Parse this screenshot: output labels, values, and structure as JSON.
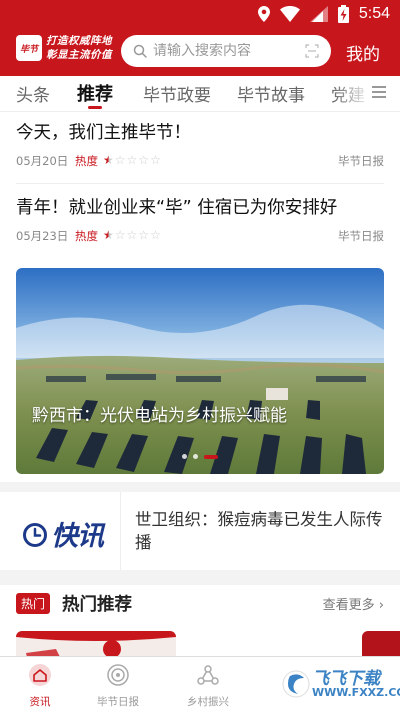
{
  "status_bar": {
    "time": "5:54",
    "icons": [
      "location-icon",
      "wifi-icon",
      "signal-icon",
      "battery-charging-icon"
    ]
  },
  "header": {
    "logo_text": "毕节",
    "slogan_line1": "打造权威阵地",
    "slogan_line2": "彰显主流价值",
    "search_placeholder": "请输入搜索内容",
    "mine_label": "我的"
  },
  "tabs": [
    {
      "label": "头条"
    },
    {
      "label": "推荐"
    },
    {
      "label": "毕节政要"
    },
    {
      "label": "毕节故事"
    },
    {
      "label": "党建"
    }
  ],
  "active_tab": "推荐",
  "news": [
    {
      "title": "今天，我们主推毕节！",
      "date": "05月20日",
      "heat_label": "热度",
      "heat_rating": 0.5,
      "source": "毕节日报"
    },
    {
      "title": "青年！就业创业来“毕” 住宿已为你安排好",
      "date": "05月23日",
      "heat_label": "热度",
      "heat_rating": 0.5,
      "source": "毕节日报"
    }
  ],
  "banner": {
    "caption": "黔西市：光伏电站为乡村振兴赋能",
    "slide_count": 3,
    "active_slide": 3
  },
  "kuaixun": {
    "logo_text": "快讯",
    "headline": "世卫组织：猴痘病毒已发生人际传播"
  },
  "hot": {
    "badge": "热门",
    "title": "热门推荐",
    "more_label": "查看更多"
  },
  "bottom_nav": [
    {
      "label": "资讯",
      "icon": "news-icon",
      "active": true
    },
    {
      "label": "毕节日报",
      "icon": "newspaper-icon",
      "active": false
    },
    {
      "label": "乡村振兴",
      "icon": "network-icon",
      "active": false
    }
  ],
  "watermark": {
    "text": "飞飞下载",
    "url": "WWW.FXXZ.COM"
  },
  "colors": {
    "brand_red": "#c8161d",
    "kuaixun_blue": "#1d3a8a"
  }
}
